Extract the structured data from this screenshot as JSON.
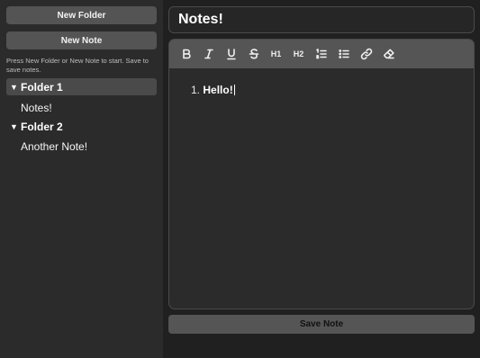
{
  "sidebar": {
    "new_folder_label": "New Folder",
    "new_note_label": "New Note",
    "hint": "Press New Folder or New Note to start. Save to save notes.",
    "folders": [
      {
        "label": "Folder 1",
        "toggle": "▼",
        "notes": [
          "Notes!"
        ]
      },
      {
        "label": "Folder 2",
        "toggle": "▼",
        "notes": [
          "Another Note!"
        ]
      }
    ]
  },
  "editor": {
    "title": "Notes!",
    "list_number": "1.",
    "content_text": "Hello!"
  },
  "toolbar": {
    "tools": [
      "bold-icon",
      "italic-icon",
      "underline-icon",
      "strikethrough-icon",
      "heading1-icon",
      "heading2-icon",
      "ordered-list-icon",
      "bullet-list-icon",
      "link-icon",
      "eraser-icon"
    ],
    "h1_text": "H1",
    "h2_text": "H2"
  },
  "footer": {
    "save_label": "Save Note"
  },
  "colors": {
    "background": "#202020",
    "sidebar": "#2b2b2b",
    "button": "#545454",
    "toolbar": "#555555"
  }
}
